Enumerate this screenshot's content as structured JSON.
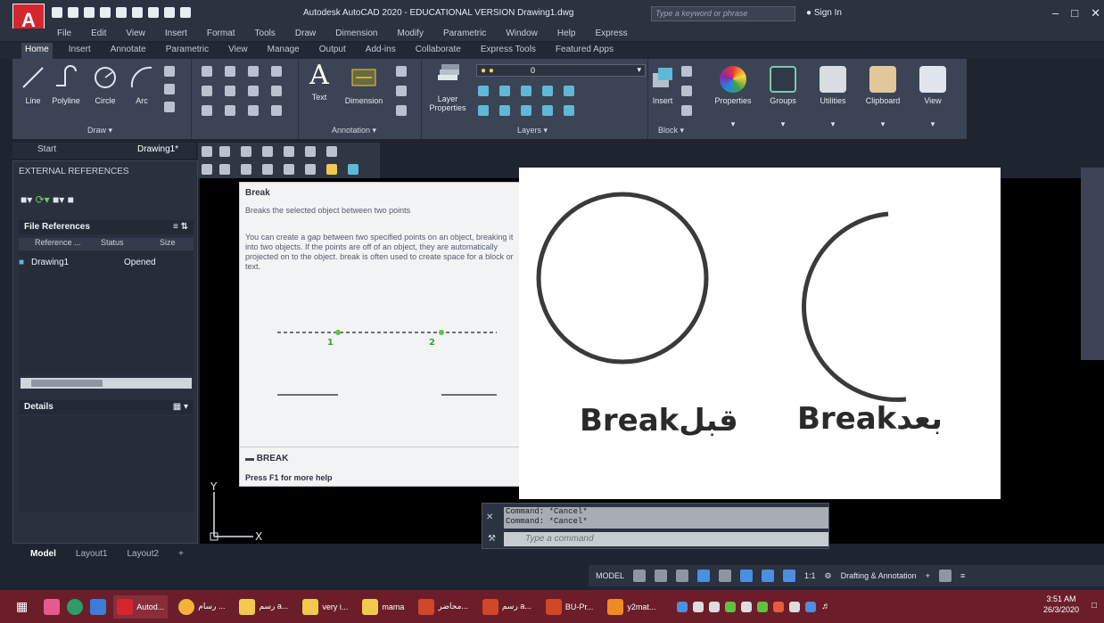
{
  "window": {
    "title": "Autodesk AutoCAD 2020 - EDUCATIONAL VERSION   Drawing1.dwg",
    "search_placeholder": "Type a keyword or phrase",
    "sign_in": "Sign In",
    "logo_letter": "A"
  },
  "menu": [
    "File",
    "Edit",
    "View",
    "Insert",
    "Format",
    "Tools",
    "Draw",
    "Dimension",
    "Modify",
    "Parametric",
    "Window",
    "Help",
    "Express"
  ],
  "ribbon_tabs": [
    "Home",
    "Insert",
    "Annotate",
    "Parametric",
    "View",
    "Manage",
    "Output",
    "Add-ins",
    "Collaborate",
    "Express Tools",
    "Featured Apps"
  ],
  "ribbon": {
    "draw": {
      "title": "Draw",
      "tools": [
        "Line",
        "Polyline",
        "Circle",
        "Arc"
      ]
    },
    "annotation": {
      "title": "Annotation",
      "tools": [
        "Text",
        "Dimension"
      ]
    },
    "layers": {
      "title": "Layers",
      "tool": "Layer Properties",
      "combo_value": "0"
    },
    "block": {
      "title": "Block",
      "tool": "Insert"
    },
    "big_tools": [
      "Properties",
      "Groups",
      "Utilities",
      "Clipboard",
      "View"
    ]
  },
  "doc_tabs": [
    "Start",
    "Drawing1*"
  ],
  "xref": {
    "title": "EXTERNAL REFERENCES",
    "file_references": "File References",
    "columns": [
      "Reference ...",
      "Status",
      "Size"
    ],
    "row": {
      "name": "Drawing1",
      "status": "Opened"
    },
    "details": "Details"
  },
  "tooltip": {
    "title": "Break",
    "short": "Breaks the selected object between two points",
    "long": "You can create a gap between two specified points on an object, breaking it into two objects. If the points are off of an object, they are automatically projected on to the object. break is often used to create space for a block or text.",
    "point1": "1",
    "point2": "2",
    "command": "BREAK",
    "help": "Press F1 for more help"
  },
  "break_image": {
    "before_label": "Breakقبل",
    "after_label": "Breakبعد"
  },
  "ucs": {
    "x": "X",
    "y": "Y"
  },
  "command_line": {
    "history": [
      "Command: *Cancel*",
      "Command: *Cancel*"
    ],
    "placeholder": "Type a command"
  },
  "layout_tabs": [
    "Model",
    "Layout1",
    "Layout2"
  ],
  "status_bar": {
    "model": "MODEL",
    "scale": "1:1",
    "workspace": "Drafting & Annotation"
  },
  "taskbar": {
    "items": [
      "Autod...",
      "رسام ...",
      "رسم a...",
      "very i...",
      "mama",
      "محاضر...",
      "رسم a...",
      "BU-Pr...",
      "y2mat..."
    ],
    "time": "3:51 AM",
    "date": "26/3/2020"
  },
  "colors": {
    "accent": "#d3262f",
    "ribbon_bg": "#3b4454",
    "taskbar": "#6b1e2a",
    "status_blue": "#4a8fe0"
  }
}
